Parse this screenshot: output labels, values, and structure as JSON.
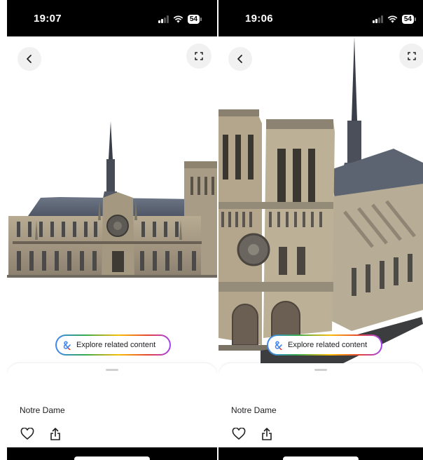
{
  "screens": [
    {
      "status": {
        "time": "19:07",
        "battery": "54"
      },
      "explore_label": "Explore related content",
      "place_title": "Notre Dame",
      "icons": {
        "back": "chevron-left-icon",
        "expand": "fullscreen-icon",
        "favorite": "heart-icon",
        "share": "share-icon"
      }
    },
    {
      "status": {
        "time": "19:06",
        "battery": "54"
      },
      "explore_label": "Explore related content",
      "place_title": "Notre Dame",
      "icons": {
        "back": "chevron-left-icon",
        "expand": "fullscreen-icon",
        "favorite": "heart-icon",
        "share": "share-icon"
      }
    }
  ],
  "colors": {
    "status_bar": "#000000",
    "sheet": "#ffffff",
    "button_bg": "#f1f1f1"
  }
}
